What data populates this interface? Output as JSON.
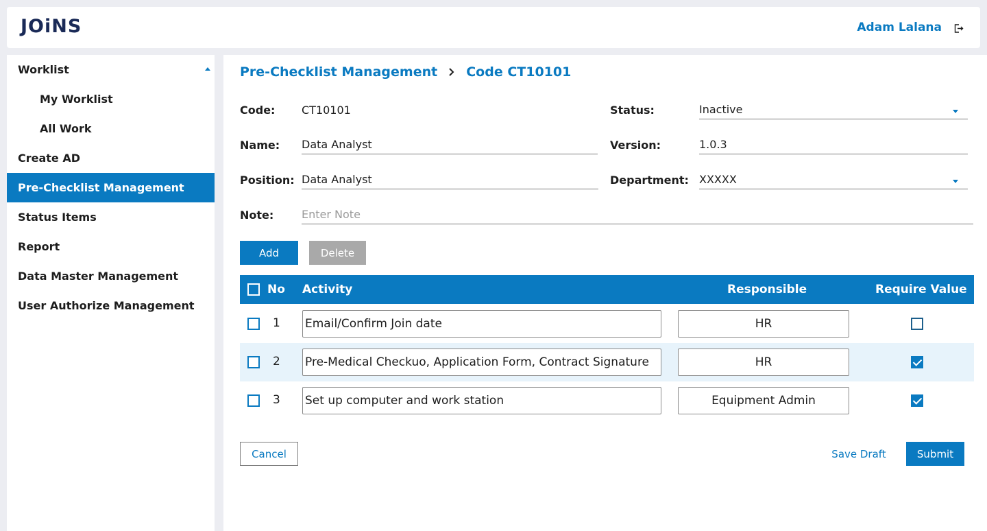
{
  "header": {
    "logo": "JOiNS",
    "user_name": "Adam Lalana",
    "logout_icon": "logout-icon"
  },
  "sidebar": {
    "items": [
      {
        "label": "Worklist"
      },
      {
        "label": "My Worklist"
      },
      {
        "label": "All Work"
      },
      {
        "label": "Create AD"
      },
      {
        "label": "Pre-Checklist Management"
      },
      {
        "label": "Status Items"
      },
      {
        "label": "Report"
      },
      {
        "label": "Data Master Management"
      },
      {
        "label": "User Authorize Management"
      }
    ]
  },
  "breadcrumb": {
    "parent": "Pre-Checklist Management",
    "current": "Code CT10101"
  },
  "form": {
    "code_label": "Code:",
    "code_value": "CT10101",
    "status_label": "Status:",
    "status_value": "Inactive",
    "name_label": "Name:",
    "name_value": "Data Analyst",
    "version_label": "Version:",
    "version_value": "1.0.3",
    "position_label": "Position:",
    "position_value": "Data Analyst",
    "department_label": "Department:",
    "department_value": "XXXXX",
    "note_label": "Note:",
    "note_placeholder": "Enter Note"
  },
  "actions": {
    "add": "Add",
    "delete": "Delete"
  },
  "table": {
    "headers": {
      "no": "No",
      "activity": "Activity",
      "responsible": "Responsible",
      "require_value": "Require Value"
    },
    "rows": [
      {
        "no": "1",
        "activity": "Email/Confirm Join date",
        "responsible": "HR",
        "require_value": false
      },
      {
        "no": "2",
        "activity": "Pre-Medical Checkuo, Application Form, Contract Signature",
        "responsible": "HR",
        "require_value": true
      },
      {
        "no": "3",
        "activity": "Set up computer and work station",
        "responsible": "Equipment Admin",
        "require_value": true
      }
    ]
  },
  "footer": {
    "cancel": "Cancel",
    "save_draft": "Save Draft",
    "submit": "Submit"
  },
  "colors": {
    "accent": "#0a7ac1",
    "brand": "#1a2a57",
    "row_highlight": "#e7f3fb",
    "disabled": "#a9a9a9"
  }
}
